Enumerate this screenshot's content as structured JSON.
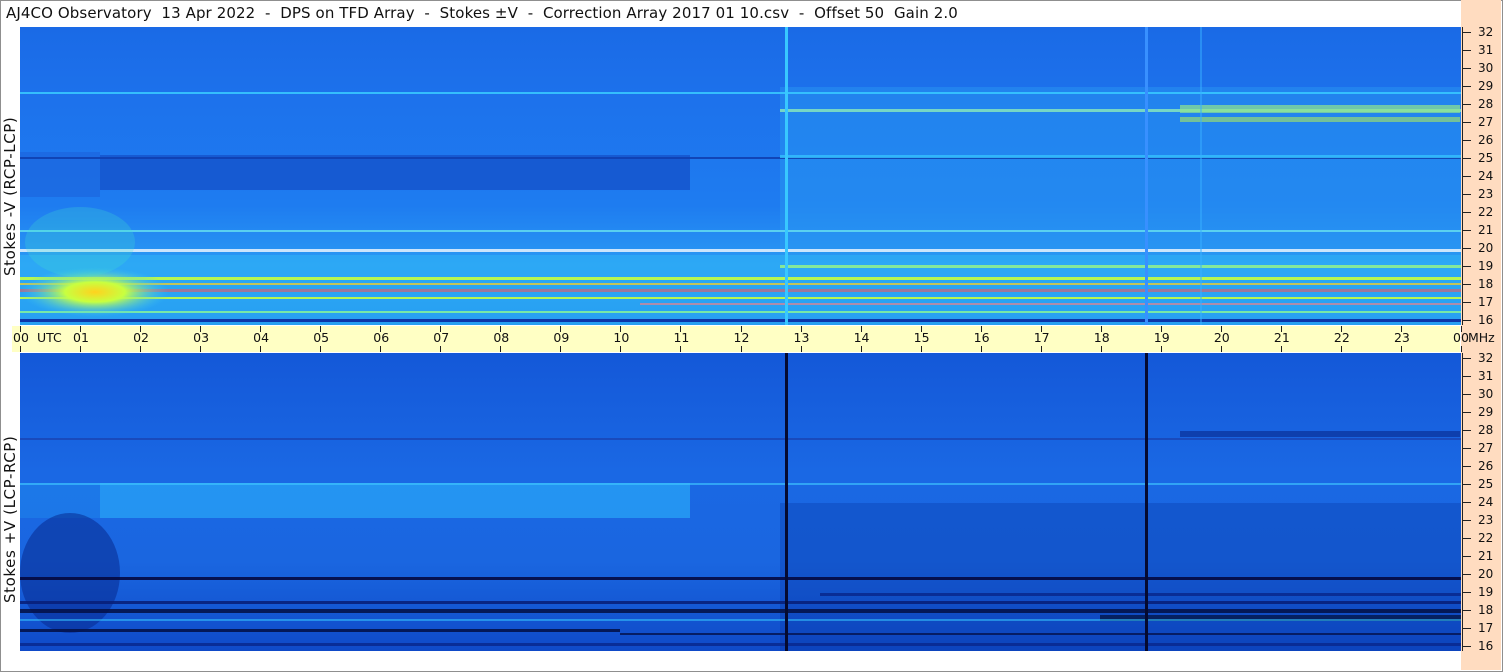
{
  "header": {
    "title": "AJ4CO Observatory  13 Apr 2022  -  DPS on TFD Array  -  Stokes ±V  -  Correction Array 2017 01 10.csv  -  Offset 50  Gain 2.0"
  },
  "panels": {
    "top_label": "Stokes -V (RCP-LCP)",
    "bottom_label": "Stokes +V (LCP-RCP)"
  },
  "time_axis": {
    "labels": [
      "00",
      "UTC",
      "01",
      "02",
      "03",
      "04",
      "05",
      "06",
      "07",
      "08",
      "09",
      "10",
      "11",
      "12",
      "13",
      "14",
      "15",
      "16",
      "17",
      "18",
      "19",
      "20",
      "21",
      "22",
      "23",
      "00",
      "MHz"
    ]
  },
  "freq_axis": {
    "labels": [
      "32",
      "31",
      "30",
      "29",
      "28",
      "27",
      "26",
      "25",
      "24",
      "23",
      "22",
      "21",
      "20",
      "19",
      "18",
      "17",
      "16"
    ]
  },
  "colors": {
    "background_blue": "#1e78ee",
    "dark_blue": "#0a3aa8",
    "cyan": "#38c8ff",
    "yellow_green": "#c8ff40",
    "timebar": "#ffffc4",
    "side_strip": "#ffdcc0"
  }
}
